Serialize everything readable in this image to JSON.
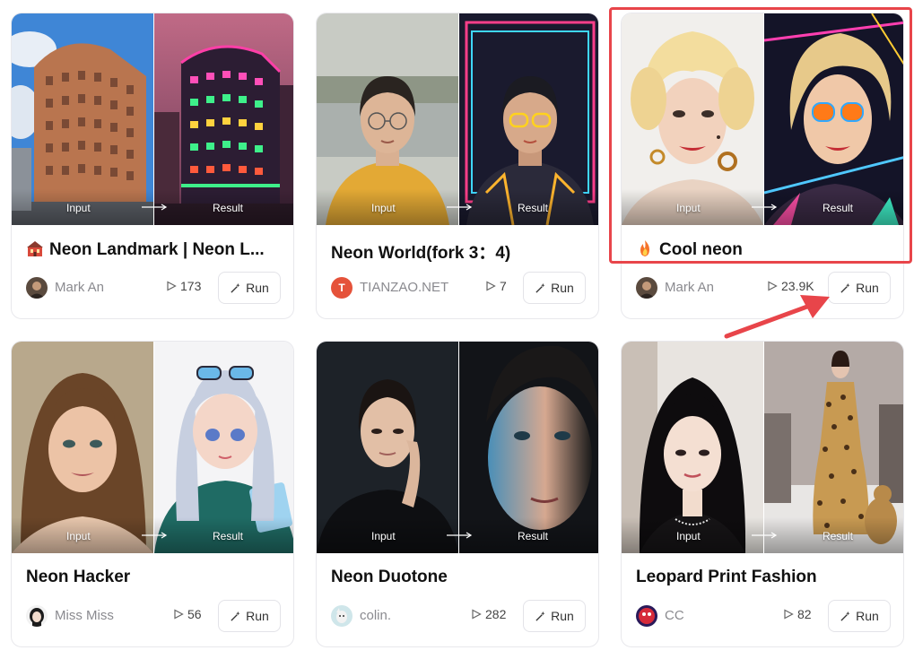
{
  "cards": [
    {
      "title": "Neon Landmark | Neon L...",
      "title_icon": "landmark-emoji-icon",
      "author": "Mark An",
      "runs": "173",
      "run_label": "Run",
      "input_label": "Input",
      "result_label": "Result"
    },
    {
      "title": "Neon World(fork 3：4)",
      "title_icon": "",
      "author": "TIANZAO.NET",
      "avatar_letter": "T",
      "runs": "7",
      "run_label": "Run",
      "input_label": "Input",
      "result_label": "Result"
    },
    {
      "title": "Cool neon",
      "title_icon": "fire-emoji-icon",
      "author": "Mark An",
      "runs": "23.9K",
      "run_label": "Run",
      "input_label": "Input",
      "result_label": "Result"
    },
    {
      "title": "Neon Hacker",
      "title_icon": "",
      "author": "Miss Miss",
      "runs": "56",
      "run_label": "Run",
      "input_label": "Input",
      "result_label": "Result"
    },
    {
      "title": "Neon Duotone",
      "title_icon": "",
      "author": "colin.",
      "runs": "282",
      "run_label": "Run",
      "input_label": "Input",
      "result_label": "Result"
    },
    {
      "title": "Leopard Print Fashion",
      "title_icon": "",
      "author": "CC",
      "runs": "82",
      "run_label": "Run",
      "input_label": "Input",
      "result_label": "Result"
    }
  ],
  "colors": {
    "highlight": "#e8454a",
    "tianzao_avatar": "#e5523a"
  }
}
